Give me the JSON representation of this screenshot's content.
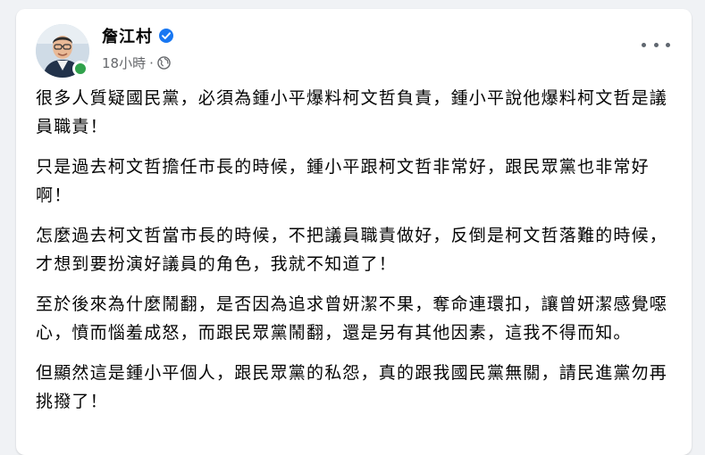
{
  "post": {
    "author": "詹江村",
    "time": "18小時",
    "separator": "·",
    "paragraphs": [
      "很多人質疑國民黨，必須為鍾小平爆料柯文哲負責，鍾小平說他爆料柯文哲是議員職責！",
      "只是過去柯文哲擔任市長的時候，鍾小平跟柯文哲非常好，跟民眾黨也非常好啊！",
      "怎麼過去柯文哲當市長的時候，不把議員職責做好，反倒是柯文哲落難的時候，才想到要扮演好議員的角色，我就不知道了！",
      "至於後來為什麼鬧翻，是否因為追求曾妍潔不果，奪命連環扣，讓曾妍潔感覺噁心，憤而惱羞成怒，而跟民眾黨鬧翻，還是另有其他因素，這我不得而知。",
      "但顯然這是鍾小平個人，跟民眾黨的私怨，真的跟我國民黨無關，請民進黨勿再挑撥了！"
    ]
  },
  "icons": {
    "verified": "verified-badge-icon",
    "audience": "globe-icon",
    "more": "more-options-icon"
  },
  "colors": {
    "verified": "#1877f2",
    "online": "#31a24c",
    "meta_text": "#65676b"
  }
}
